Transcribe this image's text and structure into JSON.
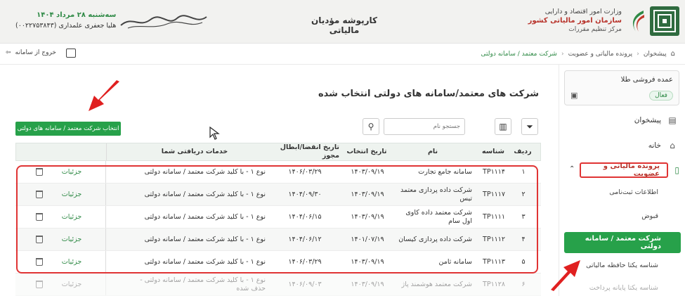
{
  "header": {
    "org_line1": "وزارت امور اقتصاد و دارایی",
    "org_line2": "سازمان امور مالیاتی کشور",
    "org_line3": "مرکز تنظیم مقررات",
    "title": "کارپوشه مؤدیان مالیاتی",
    "user_date": "سه‌شنبه ۲۸ مرداد ۱۴۰۴",
    "user_name": "هلیا جعفری علمداری (۰۰۲۲۷۵۳۸۴۳)"
  },
  "topbar": {
    "breadcrumb": [
      "پیشخوان",
      "پرونده مالیاتی و عضویت",
      "شرکت معتمد / سامانه دولتی"
    ],
    "logout": "خروج از سامانه"
  },
  "sidebar": {
    "company_name": "عمده فروشی طلا",
    "company_status": "فعال",
    "items": [
      "پیشخوان",
      "خانه",
      "پرونده مالیاتی و عضویت"
    ],
    "sub_items": [
      "اطلاعات ثبت‌نامی",
      "قبوض",
      "شرکت معتمد / سامانه دولتی",
      "شناسه یکتا حافظه مالیاتی",
      "شناسه یکتا پایانه پرداخت"
    ]
  },
  "main": {
    "page_title": "شرکت های معتمد/سامانه های دولتی انتخاب شده",
    "select_button": "انتخاب شرکت معتمد / سامانه های دولتی",
    "search_placeholder": "جستجو نام",
    "columns": [
      "ردیف",
      "شناسه",
      "نام",
      "تاریخ انتخاب",
      "تاریخ انقضا/ابطال مجوز",
      "خدمات دریافتی شما"
    ],
    "details_label": "جزئیات",
    "rows": [
      {
        "idx": "۱",
        "id": "TP۱۱۱۴",
        "name": "سامانه جامع تجارت",
        "selected": "۱۴۰۳/۰۹/۱۹",
        "expiry": "۱۴۰۶/۰۳/۲۹",
        "service": "نوع ۱ - با کلید شرکت معتمد / سامانه دولتی"
      },
      {
        "idx": "۲",
        "id": "TP۱۱۱۷",
        "name": "شرکت داده پردازی معتمد تیس",
        "selected": "۱۴۰۳/۰۹/۱۹",
        "expiry": "۱۴۰۴/۰۹/۳۰",
        "service": "نوع ۱ - با کلید شرکت معتمد / سامانه دولتی"
      },
      {
        "idx": "۳",
        "id": "TP۱۱۱۱",
        "name": "شرکت معتمد داده کاوی اول سام",
        "selected": "۱۴۰۳/۰۹/۱۹",
        "expiry": "۱۴۰۴/۰۶/۱۵",
        "service": "نوع ۱ - با کلید شرکت معتمد / سامانه دولتی"
      },
      {
        "idx": "۴",
        "id": "TP۱۱۱۲",
        "name": "شرکت داده پردازی کیسان",
        "selected": "۱۴۰۱/۰۷/۱۹",
        "expiry": "۱۴۰۴/۰۶/۱۲",
        "service": "نوع ۱ - با کلید شرکت معتمد / سامانه دولتی"
      },
      {
        "idx": "۵",
        "id": "TP۱۱۱۳",
        "name": "سامانه ثامن",
        "selected": "۱۴۰۳/۰۹/۱۹",
        "expiry": "۱۴۰۶/۰۳/۲۹",
        "service": "نوع ۱ - با کلید شرکت معتمد / سامانه دولتی"
      },
      {
        "idx": "۶",
        "id": "TP۱۱۲۸",
        "name": "شرکت معتمد هوشمند پاژ",
        "selected": "۱۴۰۳/۰۹/۱۹",
        "expiry": "۱۴۰۶/۰۹/۰۳",
        "service": "نوع ۱ - با کلید شرکت معتمد / سامانه دولتی - حذف شده"
      }
    ]
  },
  "colors": {
    "brand_green": "#27a14a",
    "highlight_red": "#e03434"
  }
}
